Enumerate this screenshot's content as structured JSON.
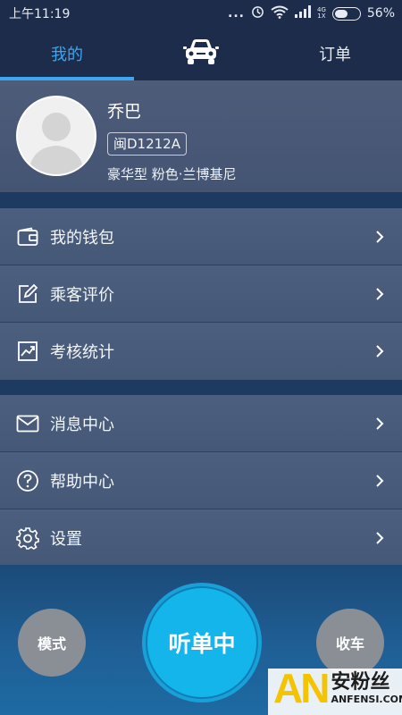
{
  "status_bar": {
    "time": "上午11:19",
    "dots": "...",
    "network_top": "4G",
    "network_bottom": "1X",
    "battery": "56%",
    "battery_level": 0.56
  },
  "tabs": [
    {
      "label": "我的",
      "active": true
    },
    {
      "icon": "car-icon",
      "active": false
    },
    {
      "label": "订单",
      "active": false
    }
  ],
  "profile": {
    "name": "乔巴",
    "plate": "闽D1212A",
    "car_desc": "豪华型 粉色·兰博基尼"
  },
  "menu_group_1": [
    {
      "label": "我的钱包",
      "icon": "wallet-icon"
    },
    {
      "label": "乘客评价",
      "icon": "edit-icon"
    },
    {
      "label": "考核统计",
      "icon": "chart-icon"
    }
  ],
  "menu_group_2": [
    {
      "label": "消息中心",
      "icon": "mail-icon"
    },
    {
      "label": "帮助中心",
      "icon": "help-icon"
    },
    {
      "label": "设置",
      "icon": "gear-icon"
    }
  ],
  "bottom": {
    "mode_label": "模式",
    "listen_label": "听单中",
    "close_label": "收车"
  },
  "watermark": {
    "logo": "AN",
    "cn": "安粉丝",
    "en": "ANFENSI.COM"
  },
  "colors": {
    "accent": "#3ea6f0",
    "listen_button": "#14b5ea",
    "header_bg": "#1c2c4a",
    "menu_bg": "#4c5f7e"
  }
}
